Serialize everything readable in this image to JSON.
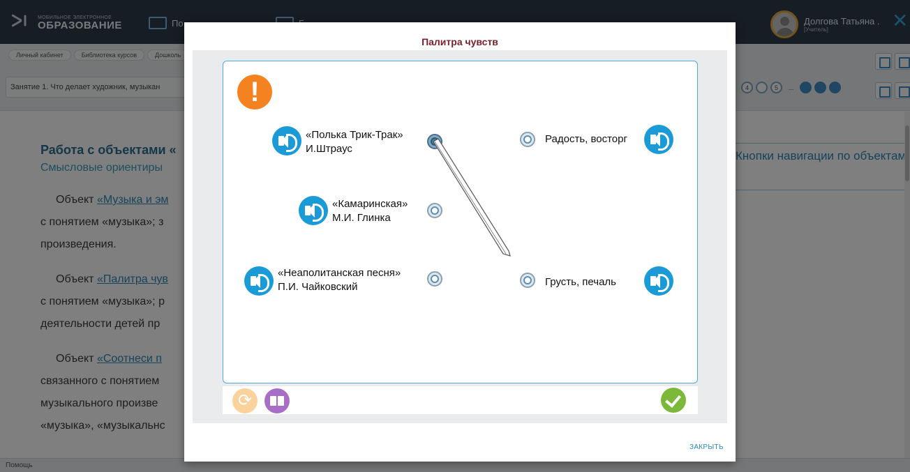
{
  "app": {
    "logo_small": "МОБИЛЬНОЕ ЭЛЕКТРОННОЕ",
    "logo_big": "ОБРАЗОВАНИЕ",
    "nav_label_1": "По",
    "nav_label_2": "Б",
    "user_name": "Долгова Татьяна .",
    "user_role": "[Учитель]"
  },
  "breadcrumbs": [
    "Личный кабинет",
    "Библиотека курсов",
    "Дошколь"
  ],
  "lesson_title": "Занятие 1. Что делает художник, музыкан",
  "pager": [
    "4",
    "",
    "5",
    "...",
    "",
    "",
    ""
  ],
  "content": {
    "title": "Работа с объектами «",
    "subtitle": "Смысловые ориентиры",
    "p1_lead": "Объект ",
    "p1_link": "«Музыка и эм",
    "p1_l2": "с понятием «музыка»; з",
    "p1_l3": "произведения.",
    "p2_lead": "Объект ",
    "p2_link": "«Палитра чув",
    "p2_l2": "с понятием «музыка»; р",
    "p2_l3": "деятельности детей пр",
    "p3_lead": "Объект ",
    "p3_link": "«Соотнеси п",
    "p3_l2": "связанного с понятием",
    "p3_l3": "музыкального произве",
    "p3_l4": "«музыка», «музыкальнс",
    "side_nav": "Кнопки навигации по объектам",
    "help": "Помощь"
  },
  "modal": {
    "title": "Палитра чувств",
    "close_label": "ЗАКРЫТЬ",
    "left_items": [
      {
        "line1": "«Полька Трик-Трак»",
        "line2": "И.Штраус"
      },
      {
        "line1": "«Камаринская»",
        "line2": "М.И. Глинка"
      },
      {
        "line1": "«Неаполитанская песня»",
        "line2": "П.И. Чайковский"
      }
    ],
    "right_items": [
      {
        "label": "Радость, восторг"
      },
      {
        "label": "Грусть, печаль"
      }
    ],
    "connection": {
      "from": "«Полька Трик-Трак» И.Штраус",
      "to": "Грусть, печаль"
    }
  },
  "colors": {
    "accent": "#1a9ad6",
    "warning": "#f58220",
    "title": "#7a1f2a",
    "check": "#7cb83a",
    "book": "#a86ec6",
    "reset": "#fbd29b"
  }
}
